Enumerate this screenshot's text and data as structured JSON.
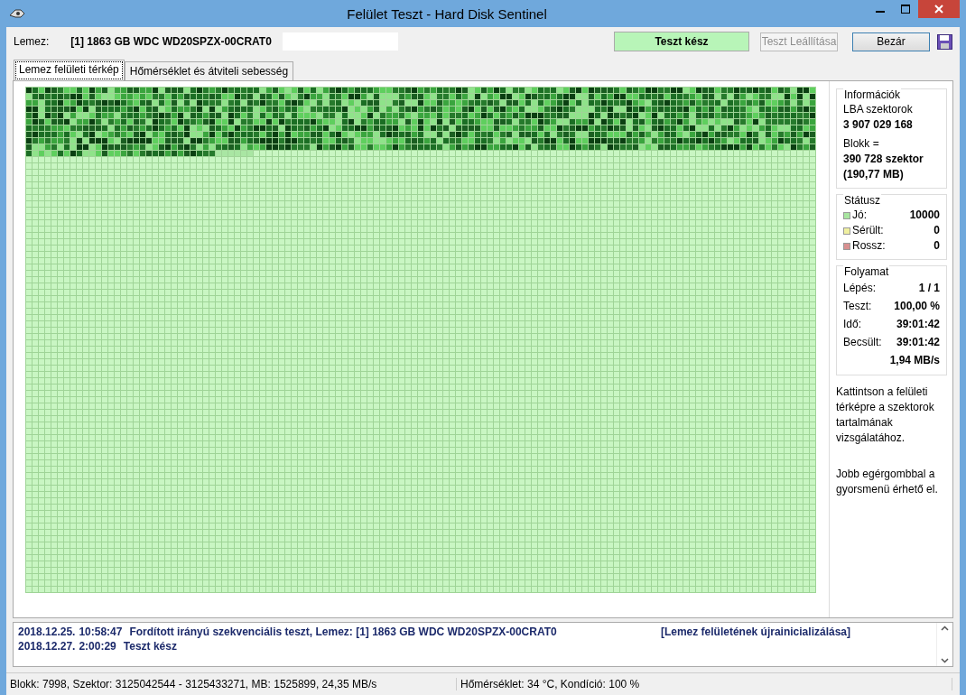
{
  "window": {
    "title": "Felület Teszt - Hard Disk Sentinel"
  },
  "toolbar": {
    "disk_label": "Lemez:",
    "disk_value": "[1] 1863 GB  WDC WD20SPZX-00CRAT0",
    "status": "Teszt kész",
    "buttons": [
      {
        "label": "Teszt Leállítása",
        "disabled": true
      },
      {
        "label": "Bezár",
        "disabled": false
      }
    ]
  },
  "tabs": [
    {
      "label": "Lemez felületi térkép",
      "selected": true
    },
    {
      "label": "Hőmérséklet és átviteli sebesség",
      "selected": false
    }
  ],
  "info": {
    "title": "Információk",
    "lba_label": "LBA szektorok",
    "lba_value": "3 907 029 168",
    "block_label": "Blokk =",
    "block_value": "390 728 szektor",
    "block_size": "(190,77 MB)"
  },
  "status": {
    "title": "Státusz",
    "items": [
      {
        "label": "Jó:",
        "value": "10000",
        "color": "#a8e6a0"
      },
      {
        "label": "Sérült:",
        "value": "0",
        "color": "#f0f0a0"
      },
      {
        "label": "Rossz:",
        "value": "0",
        "color": "#d89090"
      }
    ]
  },
  "progress": {
    "title": "Folyamat",
    "rows": [
      {
        "label": "Lépés:",
        "value": "1 / 1"
      },
      {
        "label": "Teszt:",
        "value": "100,00 %"
      },
      {
        "label": "Idő:",
        "value": "39:01:42"
      },
      {
        "label": "Becsült:",
        "value": "39:01:42"
      },
      {
        "value": "1,94 MB/s"
      }
    ]
  },
  "hints": [
    "Kattintson a felületi térképre a szektorok tartalmának vizsgálatához.",
    "Jobb egérgombbal a gyorsmenü érhető el."
  ],
  "log": [
    {
      "date": "2018.12.25.",
      "time": "10:58:47",
      "message": "Fordított irányú szekvenciális teszt, Lemez: [1] 1863 GB  WDC WD20SPZX-00CRAT0",
      "note": "[Lemez felületének újrainicializálása]"
    },
    {
      "date": "2018.12.27.",
      "time": "2:00:29",
      "message": "Teszt kész"
    }
  ],
  "status_bar": [
    "Blokk: 7998, Szektor: 3125042544 - 3125433271, MB: 1525899, 24,35 MB/s",
    "Hőmérséklet: 34  °C,  Kondíció: 100 %"
  ]
}
